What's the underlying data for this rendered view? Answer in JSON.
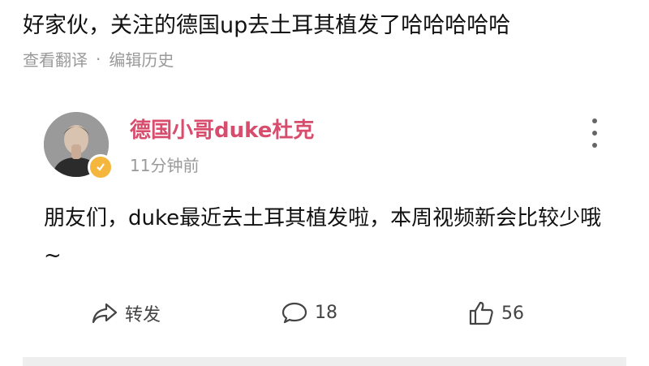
{
  "top_post": {
    "text": "好家伙，关注的德国up去土耳其植发了哈哈哈哈哈",
    "view_translation": "查看翻译",
    "separator": "·",
    "edit_history": "编辑历史"
  },
  "card": {
    "username": "德国小哥duke杜克",
    "timestamp": "11分钟前",
    "body": "朋友们，duke最近去土耳其植发啦，本周视频新会比较少哦~",
    "actions": {
      "share_label": "转发",
      "comment_count": "18",
      "like_count": "56"
    }
  },
  "colors": {
    "username": "#d84d6e",
    "meta_grey": "#9a9a9a",
    "badge": "#f4b63c"
  },
  "icons": [
    "share-icon",
    "comment-icon",
    "like-icon",
    "more-icon",
    "verified-badge-icon"
  ]
}
